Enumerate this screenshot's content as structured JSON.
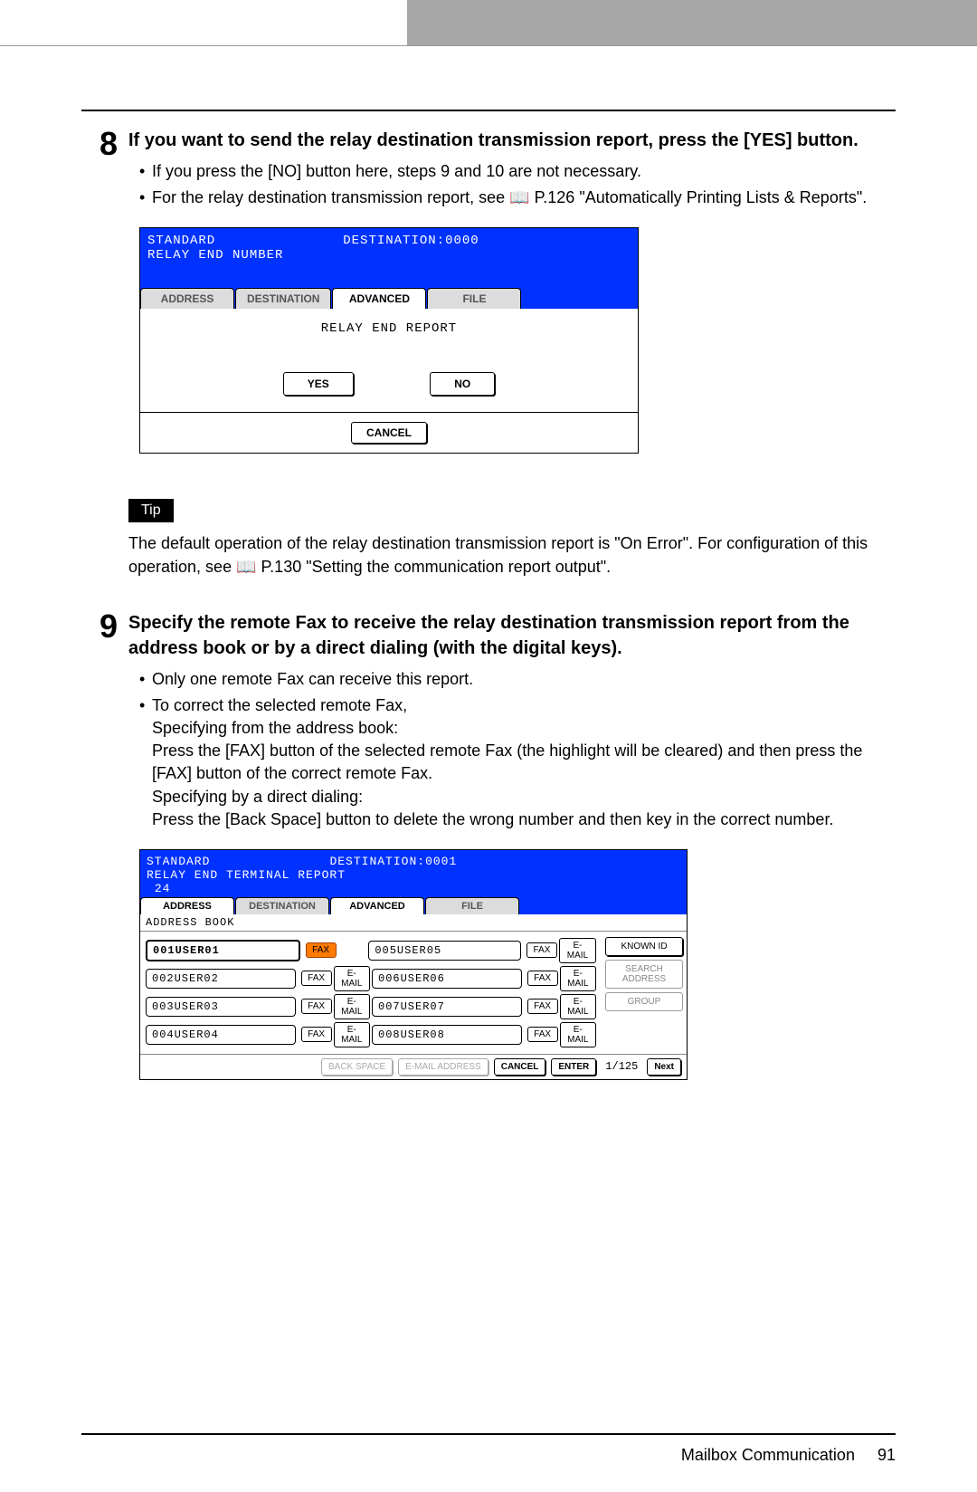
{
  "step8": {
    "num": "8",
    "title": "If you want to send the relay destination transmission report, press the [YES] button.",
    "bullets": [
      "If you press the [NO] button here, steps 9 and 10 are not necessary.",
      "For the relay destination transmission report, see 📖 P.126 \"Automatically Printing Lists & Reports\"."
    ]
  },
  "panel1": {
    "header_l1": "STANDARD",
    "header_r1": "DESTINATION:0000",
    "header_l2": "RELAY END NUMBER",
    "tabs": [
      "ADDRESS",
      "DESTINATION",
      "ADVANCED",
      "FILE"
    ],
    "active_tab": 2,
    "body_label": "RELAY END REPORT",
    "yes": "YES",
    "no": "NO",
    "cancel": "CANCEL"
  },
  "tip": {
    "chip": "Tip",
    "text": "The default operation of the relay destination transmission report is \"On Error\". For configuration of this operation, see 📖 P.130 \"Setting the communication report output\"."
  },
  "step9": {
    "num": "9",
    "title": "Specify the remote Fax to receive the relay destination transmission report from the address book or by a direct dialing (with the digital keys).",
    "b1": "Only one remote Fax can receive this report.",
    "b2a": "To correct the selected remote Fax,",
    "b2b": "Specifying from the address book:",
    "b2c": "Press the [FAX] button of the selected remote Fax (the highlight will be cleared) and then press the [FAX] button of the correct remote Fax.",
    "b2d": "Specifying by a direct dialing:",
    "b2e": "Press the [Back Space] button to delete the wrong number and then key in the correct number."
  },
  "panel2": {
    "header_l1": "STANDARD",
    "header_r1": "DESTINATION:0001",
    "header_l2": "RELAY END TERMINAL REPORT",
    "header_l3": "24",
    "tabs": [
      "ADDRESS",
      "DESTINATION",
      "ADVANCED",
      "FILE"
    ],
    "active_tab": 0,
    "sub": "ADDRESS BOOK",
    "entries_left": [
      "001USER01",
      "002USER02",
      "003USER03",
      "004USER04"
    ],
    "entries_right": [
      "005USER05",
      "006USER06",
      "007USER07",
      "008USER08"
    ],
    "fax": "FAX",
    "email": "E-MAIL",
    "side": [
      "KNOWN ID",
      "SEARCH ADDRESS",
      "GROUP"
    ],
    "foot": {
      "backspace": "BACK SPACE",
      "emailaddr": "E-MAIL ADDRESS",
      "cancel": "CANCEL",
      "enter": "ENTER",
      "page": "1/125",
      "next": "Next"
    }
  },
  "footer": {
    "label": "Mailbox Communication",
    "page": "91"
  }
}
